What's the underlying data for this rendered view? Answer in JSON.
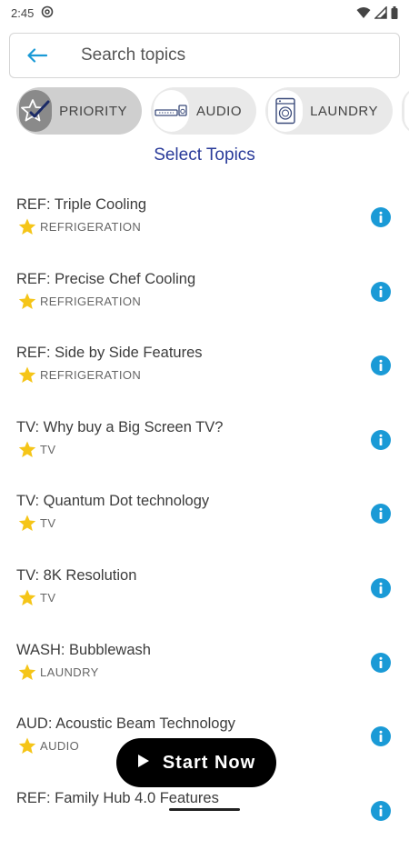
{
  "status_bar": {
    "time": "2:45",
    "left_icon": "at-sign-icon",
    "right_icons": [
      "wifi-icon",
      "signal-icon",
      "battery-icon"
    ]
  },
  "search": {
    "placeholder": "Search topics",
    "value": "",
    "back_icon": "back-arrow-icon"
  },
  "chips": [
    {
      "label": "PRIORITY",
      "icon": "star-check-icon",
      "selected": true
    },
    {
      "label": "AUDIO",
      "icon": "soundbar-icon",
      "selected": false
    },
    {
      "label": "LAUNDRY",
      "icon": "washing-machine-icon",
      "selected": false
    },
    {
      "label": "",
      "icon": "more-chip-icon",
      "selected": false
    }
  ],
  "select_topics_label": "Select Topics",
  "topics": [
    {
      "title": "REF: Triple Cooling",
      "category": "REFRIGERATION"
    },
    {
      "title": "REF: Precise Chef Cooling",
      "category": "REFRIGERATION"
    },
    {
      "title": "REF: Side by Side Features",
      "category": "REFRIGERATION"
    },
    {
      "title": "TV: Why buy a Big Screen TV?",
      "category": "TV"
    },
    {
      "title": "TV: Quantum Dot technology",
      "category": "TV"
    },
    {
      "title": "TV: 8K Resolution",
      "category": "TV"
    },
    {
      "title": "WASH: Bubblewash",
      "category": "LAUNDRY"
    },
    {
      "title": "AUD: Acoustic Beam Technology",
      "category": "AUDIO"
    },
    {
      "title": "REF: Family Hub 4.0 Features",
      "category": ""
    }
  ],
  "start_button": {
    "label": "Start Now",
    "icon": "play-icon"
  },
  "colors": {
    "accent_blue": "#1a9ad6",
    "star": "#f5c518",
    "select_topics": "#2a3b9a",
    "start_button_bg": "#000000"
  }
}
